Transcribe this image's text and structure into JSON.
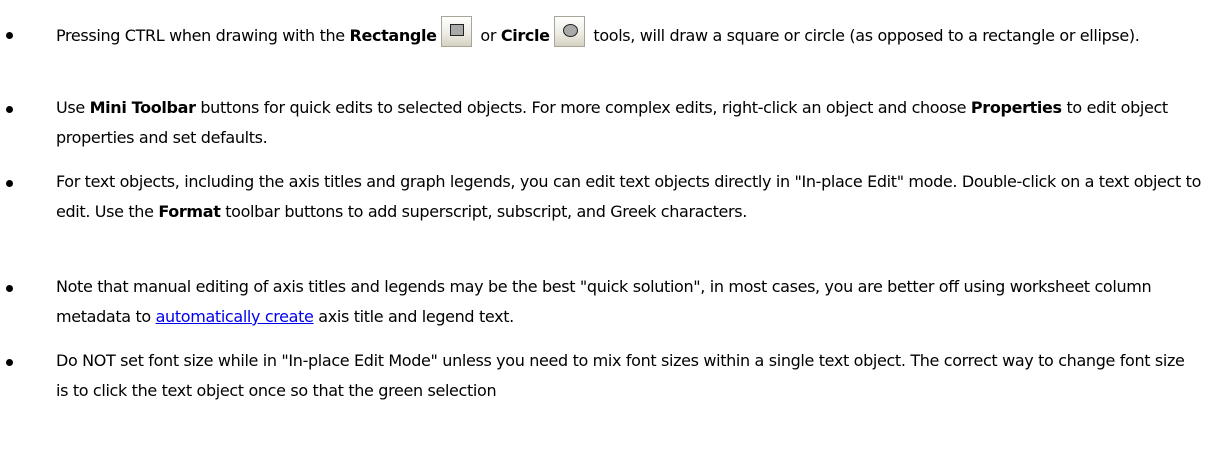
{
  "tips": [
    {
      "seg1": "Pressing CTRL when drawing with the ",
      "bold1": "Rectangle",
      "rect_icon": "rectangle-tool-icon",
      "seg2": " or ",
      "bold2": "Circle",
      "circle_icon": "circle-tool-icon",
      "seg3": " tools, will draw a square or circle (as opposed to a rectangle or ellipse)."
    },
    {
      "seg1": "Use ",
      "bold1": "Mini Toolbar",
      "seg2": " buttons for quick edits to selected objects. For more complex edits, right-click an object and choose ",
      "bold2": "Properties",
      "seg3": " to edit object properties and set defaults."
    },
    {
      "seg1": "For text objects, including the axis titles and graph legends, you can edit text objects directly in \"In-place Edit\" mode. Double-click on a text object to edit. Use the ",
      "bold1": "Format",
      "seg2": " toolbar buttons to add superscript, subscript, and Greek characters."
    },
    {
      "seg1": "Note that manual editing of axis titles and legends may be the best \"quick solution\", in most cases, you are better off using worksheet column metadata to ",
      "link": "automatically create",
      "seg2": " axis title and legend text."
    },
    {
      "seg1": "Do NOT set font size while in \"In-place Edit Mode\" unless you need to mix font sizes within a single text object. The correct way to change font size is to click the text object once so that the green selection"
    }
  ]
}
